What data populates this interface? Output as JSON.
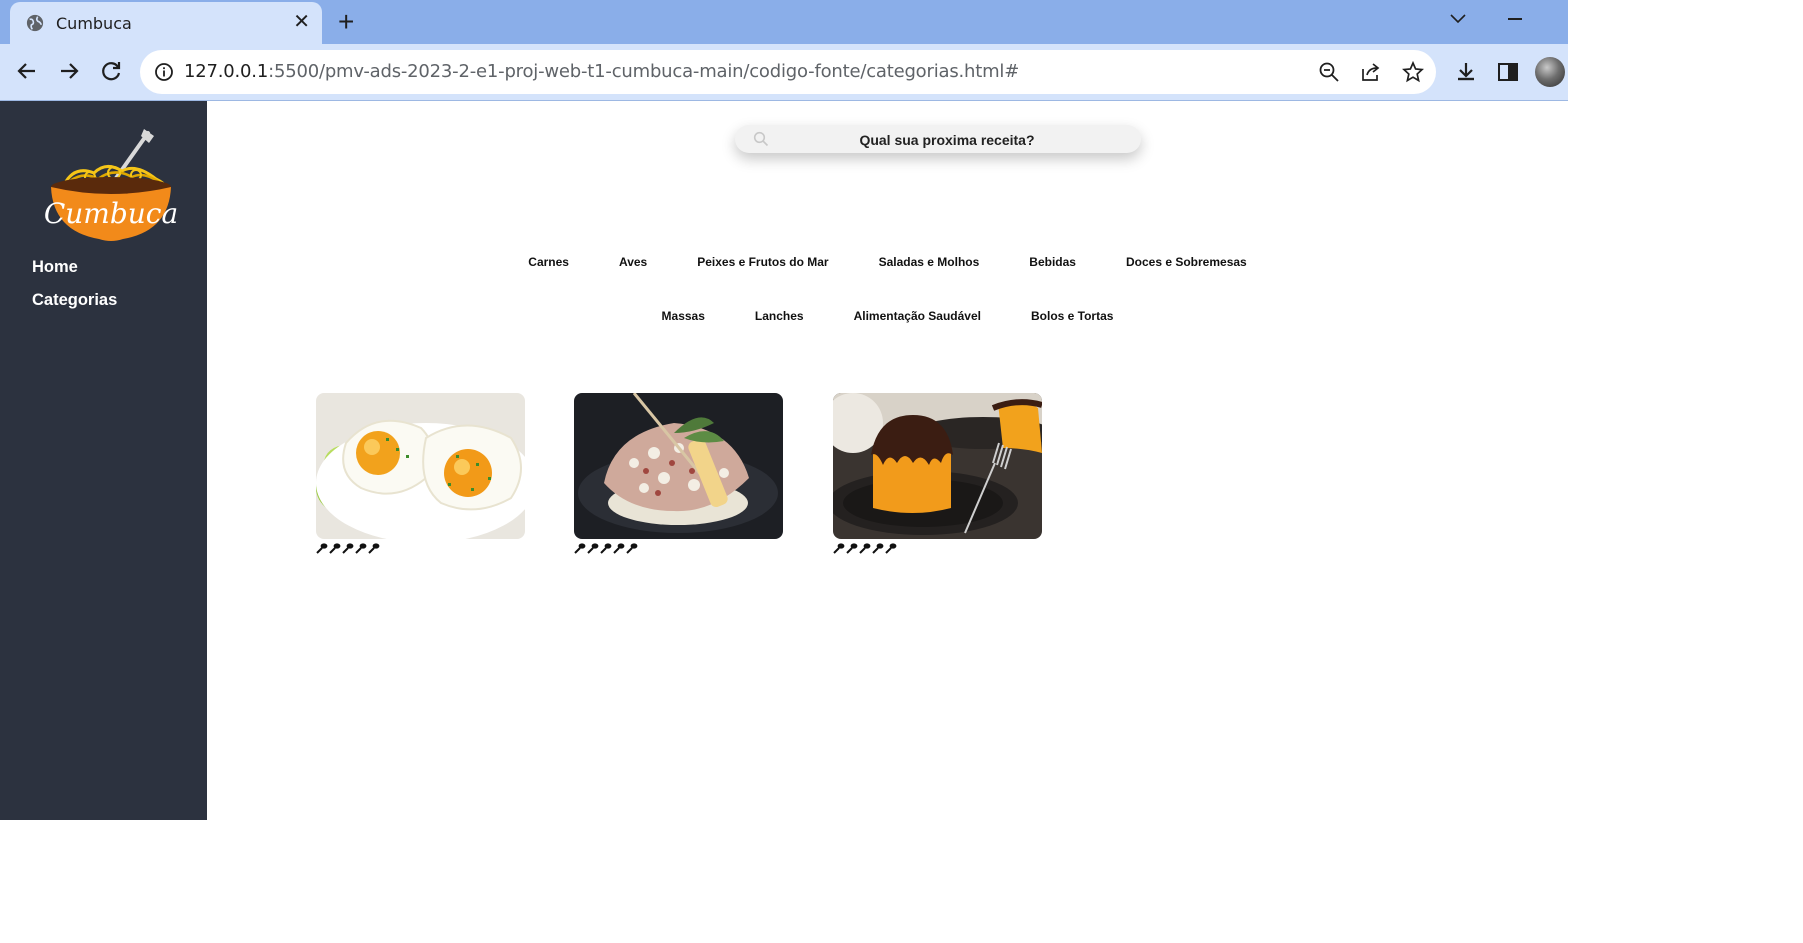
{
  "browser": {
    "tab_title": "Cumbuca",
    "tab_close": "✕",
    "new_tab": "+",
    "url_host": "127.0.0.1",
    "url_path": ":5500/pmv-ads-2023-2-e1-proj-web-t1-cumbuca-main/codigo-fonte/categorias.html#"
  },
  "sidebar": {
    "logo_text": "Cumbuca",
    "links": [
      {
        "label": "Home"
      },
      {
        "label": "Categorias"
      }
    ]
  },
  "search": {
    "placeholder": "Qual sua proxima receita?"
  },
  "categories": {
    "row1": [
      "Carnes",
      "Aves",
      "Peixes e Frutos do Mar",
      "Saladas e Molhos",
      "Bebidas",
      "Doces e Sobremesas"
    ],
    "row2": [
      "Massas",
      "Lanches",
      "Alimentação Saudável",
      "Bolos e Tortas"
    ]
  },
  "recipes": [
    {
      "image": "fried-eggs",
      "rating": 5
    },
    {
      "image": "rice-skewer-dish",
      "rating": 5
    },
    {
      "image": "carrot-cake-chocolate",
      "rating": 5
    }
  ],
  "colors": {
    "tabbar": "#8aaee9",
    "toolbar": "#d4e3fb",
    "sidebar": "#2c323f",
    "logo_orange": "#f28a1a"
  }
}
